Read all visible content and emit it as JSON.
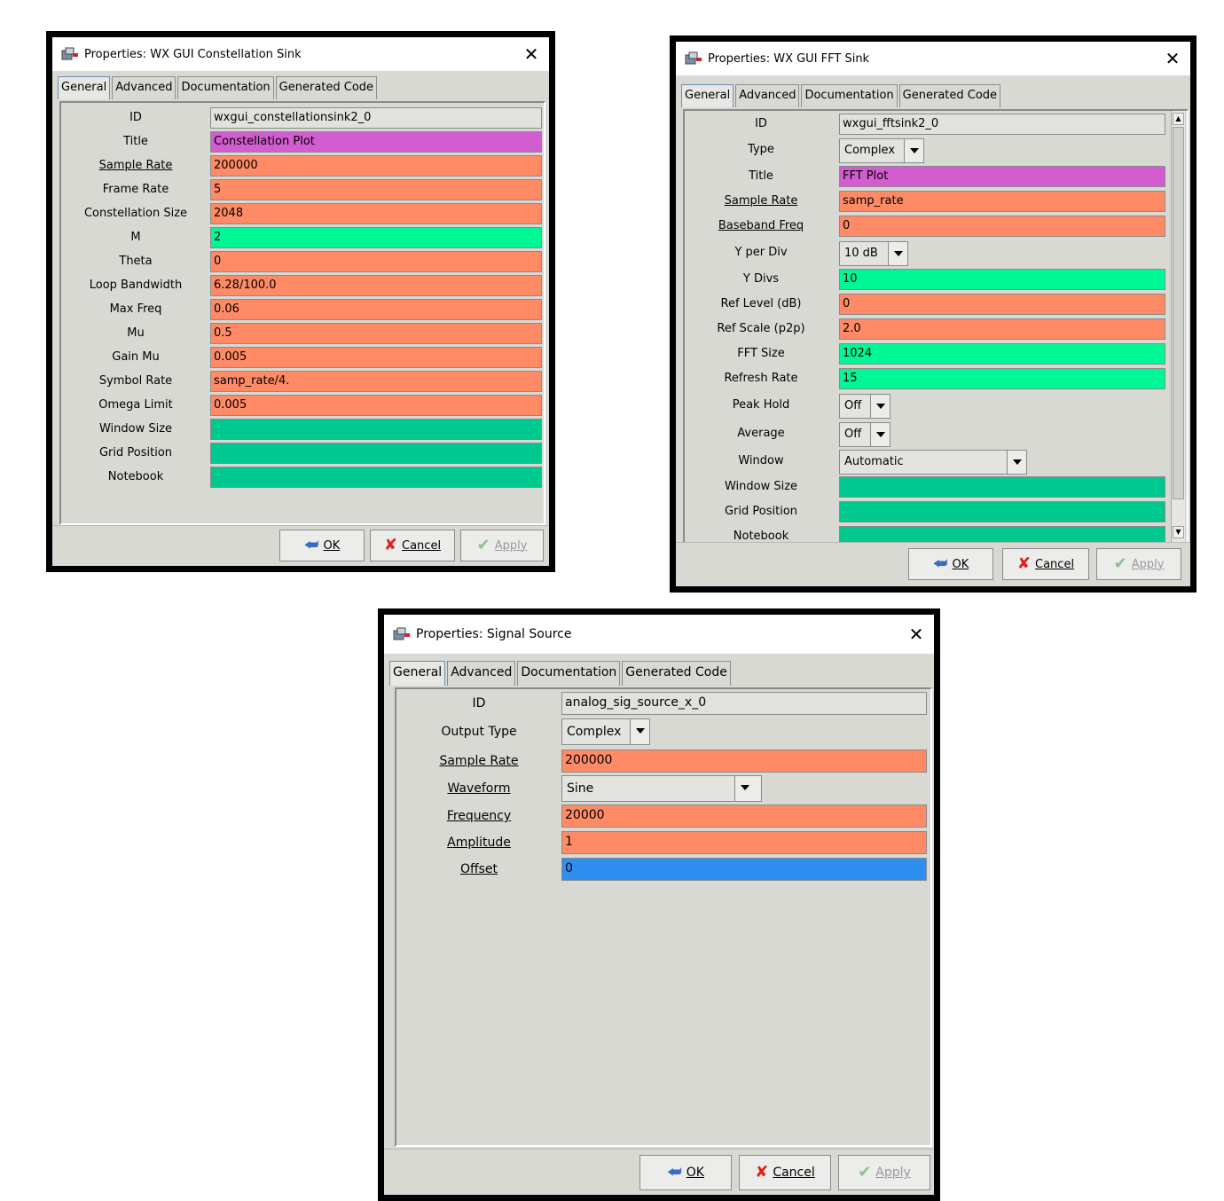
{
  "colors": {
    "title_field": "#d25cd0",
    "orange_field": "#ff8a66",
    "bright_green": "#00f796",
    "teal_field": "#00c98f",
    "blue_field": "#2f8ff0",
    "readonly_field": "#e1e1dd"
  },
  "dialogs": [
    {
      "title": "Properties: WX GUI Constellation Sink",
      "tabs": [
        "General",
        "Advanced",
        "Documentation",
        "Generated Code"
      ],
      "rows": [
        {
          "label": "ID",
          "value": "wxgui_constellationsink2_0",
          "color": "readonly"
        },
        {
          "label": "Title",
          "value": "Constellation Plot",
          "color": "title"
        },
        {
          "label": "Sample Rate",
          "value": "200000",
          "color": "orange",
          "underline": true
        },
        {
          "label": "Frame Rate",
          "value": "5",
          "color": "orange"
        },
        {
          "label": "Constellation Size",
          "value": "2048",
          "color": "orange"
        },
        {
          "label": "M",
          "value": "2",
          "color": "green"
        },
        {
          "label": "Theta",
          "value": "0",
          "color": "orange"
        },
        {
          "label": "Loop Bandwidth",
          "value": "6.28/100.0",
          "color": "orange"
        },
        {
          "label": "Max Freq",
          "value": "0.06",
          "color": "orange"
        },
        {
          "label": "Mu",
          "value": "0.5",
          "color": "orange"
        },
        {
          "label": "Gain Mu",
          "value": "0.005",
          "color": "orange"
        },
        {
          "label": "Symbol Rate",
          "value": "samp_rate/4.",
          "color": "orange"
        },
        {
          "label": "Omega Limit",
          "value": "0.005",
          "color": "orange"
        },
        {
          "label": "Window Size",
          "value": "",
          "color": "teal"
        },
        {
          "label": "Grid Position",
          "value": "",
          "color": "teal"
        },
        {
          "label": "Notebook",
          "value": "",
          "color": "teal"
        }
      ],
      "buttons": {
        "ok": "OK",
        "cancel": "Cancel",
        "apply": "Apply"
      }
    },
    {
      "title": "Properties: WX GUI FFT Sink",
      "tabs": [
        "General",
        "Advanced",
        "Documentation",
        "Generated Code"
      ],
      "rows": [
        {
          "label": "ID",
          "value": "wxgui_fftsink2_0",
          "color": "readonly"
        },
        {
          "label": "Type",
          "value": "Complex",
          "kind": "combo"
        },
        {
          "label": "Title",
          "value": "FFT Plot",
          "color": "title"
        },
        {
          "label": "Sample Rate",
          "value": "samp_rate",
          "color": "orange",
          "underline": true
        },
        {
          "label": "Baseband Freq",
          "value": "0",
          "color": "orange",
          "underline": true
        },
        {
          "label": "Y per Div",
          "value": "10 dB",
          "kind": "combo"
        },
        {
          "label": "Y Divs",
          "value": "10",
          "color": "green"
        },
        {
          "label": "Ref Level (dB)",
          "value": "0",
          "color": "orange"
        },
        {
          "label": "Ref Scale (p2p)",
          "value": "2.0",
          "color": "orange"
        },
        {
          "label": "FFT Size",
          "value": "1024",
          "color": "green"
        },
        {
          "label": "Refresh Rate",
          "value": "15",
          "color": "green"
        },
        {
          "label": "Peak Hold",
          "value": "Off",
          "kind": "combo"
        },
        {
          "label": "Average",
          "value": "Off",
          "kind": "combo"
        },
        {
          "label": "Window",
          "value": "Automatic",
          "kind": "combo"
        },
        {
          "label": "Window Size",
          "value": "",
          "color": "teal"
        },
        {
          "label": "Grid Position",
          "value": "",
          "color": "teal"
        },
        {
          "label": "Notebook",
          "value": "",
          "color": "teal"
        }
      ],
      "buttons": {
        "ok": "OK",
        "cancel": "Cancel",
        "apply": "Apply"
      }
    },
    {
      "title": "Properties: Signal Source",
      "tabs": [
        "General",
        "Advanced",
        "Documentation",
        "Generated Code"
      ],
      "rows": [
        {
          "label": "ID",
          "value": "analog_sig_source_x_0",
          "color": "readonly"
        },
        {
          "label": "Output Type",
          "value": "Complex",
          "kind": "combo"
        },
        {
          "label": "Sample Rate",
          "value": "200000",
          "color": "orange",
          "underline": true
        },
        {
          "label": "Waveform",
          "value": "Sine",
          "kind": "combo",
          "underline": true
        },
        {
          "label": "Frequency",
          "value": "20000",
          "color": "orange",
          "underline": true
        },
        {
          "label": "Amplitude",
          "value": "1",
          "color": "orange",
          "underline": true
        },
        {
          "label": "Offset",
          "value": "0",
          "color": "blue",
          "underline": true
        }
      ],
      "buttons": {
        "ok": "OK",
        "cancel": "Cancel",
        "apply": "Apply"
      }
    }
  ]
}
